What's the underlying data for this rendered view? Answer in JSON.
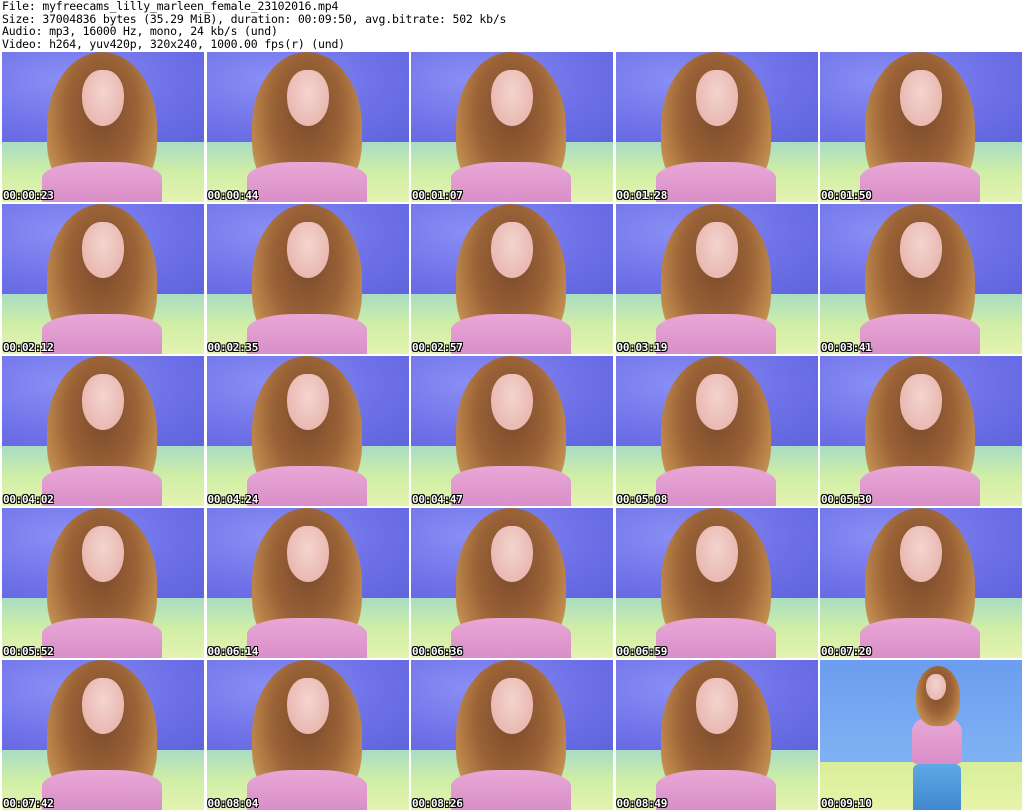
{
  "header": {
    "file": "File: myfreecams_lilly_marleen_female_23102016.mp4",
    "size": "Size: 37004836 bytes (35.29 MiB), duration: 00:09:50, avg.bitrate: 502 kb/s",
    "audio": "Audio: mp3, 16000 Hz, mono, 24 kb/s (und)",
    "video": "Video: h264, yuv420p, 320x240, 1000.00 fps(r) (und)"
  },
  "thumbnails": [
    {
      "time": "00:00:23"
    },
    {
      "time": "00:00:44"
    },
    {
      "time": "00:01:07"
    },
    {
      "time": "00:01:28"
    },
    {
      "time": "00:01:50"
    },
    {
      "time": "00:02:12"
    },
    {
      "time": "00:02:35"
    },
    {
      "time": "00:02:57"
    },
    {
      "time": "00:03:19"
    },
    {
      "time": "00:03:41"
    },
    {
      "time": "00:04:02"
    },
    {
      "time": "00:04:24"
    },
    {
      "time": "00:04:47"
    },
    {
      "time": "00:05:08"
    },
    {
      "time": "00:05:30"
    },
    {
      "time": "00:05:52"
    },
    {
      "time": "00:06:14"
    },
    {
      "time": "00:06:36"
    },
    {
      "time": "00:06:59"
    },
    {
      "time": "00:07:20"
    },
    {
      "time": "00:07:42"
    },
    {
      "time": "00:08:04"
    },
    {
      "time": "00:08:26"
    },
    {
      "time": "00:08:49"
    },
    {
      "time": "00:09:10"
    }
  ]
}
